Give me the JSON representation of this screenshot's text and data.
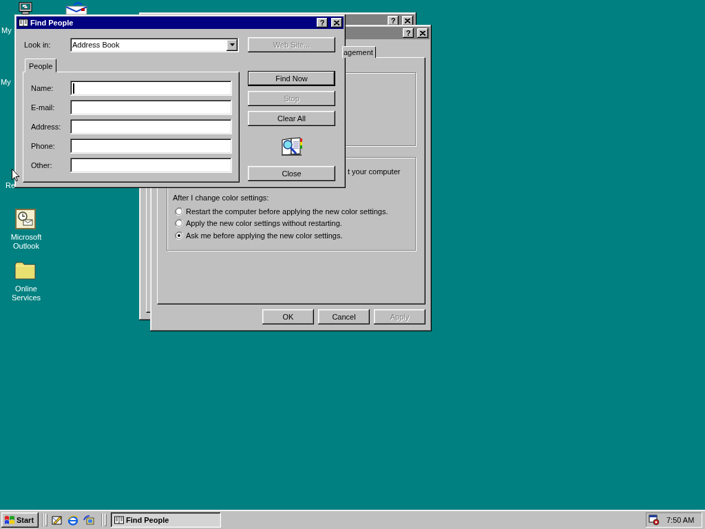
{
  "desktop_icons": [
    {
      "kind": "computer",
      "label": "My"
    },
    {
      "kind": "inbox"
    },
    {
      "kind": "label_only",
      "label": "My"
    },
    {
      "kind": "label_only",
      "label": "Re"
    },
    {
      "kind": "outlook",
      "label": "Microsoft Outlook"
    },
    {
      "kind": "folder",
      "label": "Online Services"
    }
  ],
  "back_window": {
    "active": false,
    "help_button": "?"
  },
  "display_properties": {
    "active": false,
    "help_button": "?",
    "tabs": [
      {
        "label": "agement",
        "selected": true
      }
    ],
    "note": "t your computer",
    "group_label": "After I change color settings:",
    "radios": [
      {
        "label": "Restart the computer before applying the new color settings.",
        "selected": false
      },
      {
        "label": "Apply the new color settings without restarting.",
        "selected": false
      },
      {
        "label": "Ask me before applying the new color settings.",
        "selected": true
      }
    ],
    "buttons": [
      {
        "label": "OK",
        "disabled": false
      },
      {
        "label": "Cancel",
        "disabled": false
      },
      {
        "label": "Apply",
        "disabled": true
      }
    ]
  },
  "find_people": {
    "title": "Find People",
    "active": true,
    "help_button": "?",
    "look_in": {
      "label": "Look in:",
      "value": "Address Book"
    },
    "web_site_button": {
      "label": "Web Site...",
      "disabled": true
    },
    "tabs": [
      {
        "label": "People",
        "selected": true
      }
    ],
    "fields": [
      {
        "label": "Name:",
        "focused": true
      },
      {
        "label": "E-mail:",
        "focused": false
      },
      {
        "label": "Address:",
        "focused": false
      },
      {
        "label": "Phone:",
        "focused": false
      },
      {
        "label": "Other:",
        "focused": false
      }
    ],
    "buttons": [
      {
        "label": "Find Now",
        "disabled": false,
        "default": true
      },
      {
        "label": "Stop",
        "disabled": true,
        "default": false
      },
      {
        "label": "Clear All",
        "disabled": false,
        "default": false
      }
    ],
    "close_button": {
      "label": "Close",
      "disabled": false
    }
  },
  "taskbar": {
    "start": "Start",
    "quick_launch": [
      {
        "kind": "desktop"
      },
      {
        "kind": "browser"
      },
      {
        "kind": "channels"
      }
    ],
    "tasks": [
      {
        "label": "Find People",
        "selected": true
      }
    ],
    "clock": "7:50 AM"
  }
}
